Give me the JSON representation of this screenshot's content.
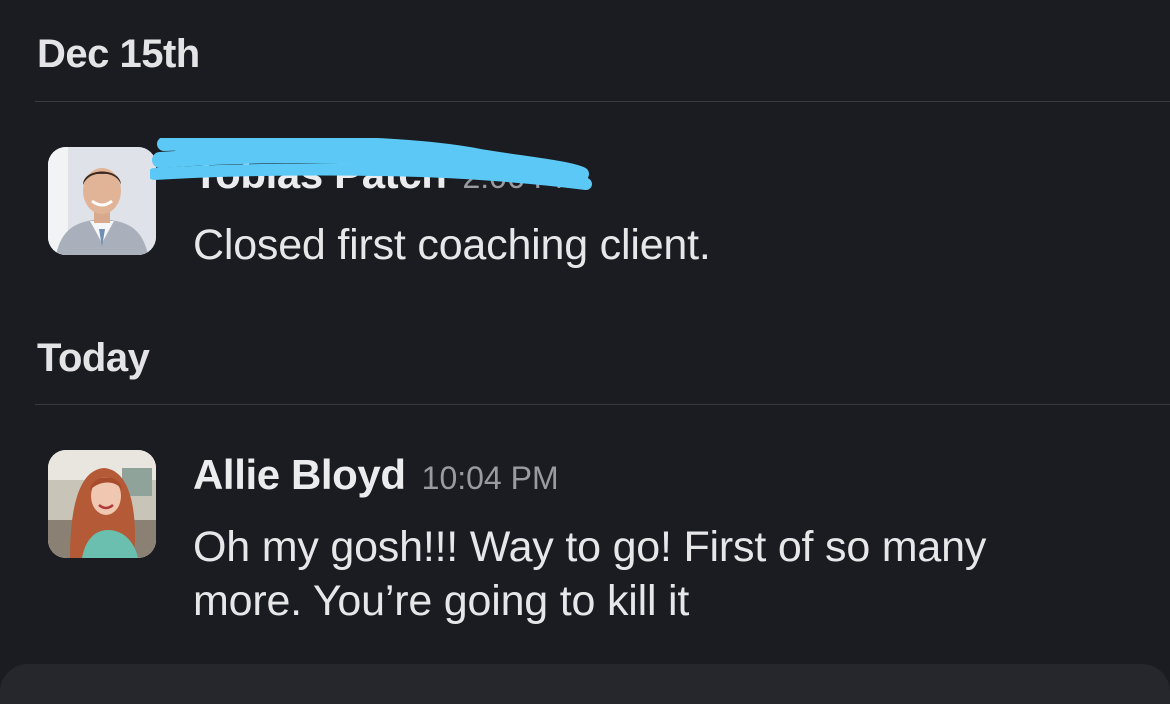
{
  "sections": [
    {
      "date_label": "Dec 15th",
      "message": {
        "author": "Tobias Patch",
        "time": "2:06 PM",
        "text": "Closed first coaching client.",
        "avatar": "man-in-suit-photo",
        "name_redacted": true
      }
    },
    {
      "date_label": "Today",
      "message": {
        "author": "Allie Bloyd",
        "time": "10:04 PM",
        "text": "Oh my gosh!!! Way to go! First of so many more. You’re going to kill it",
        "avatar": "red-haired-woman-photo"
      }
    }
  ],
  "colors": {
    "background": "#1b1c21",
    "redaction_scribble": "#5bc8f5"
  }
}
